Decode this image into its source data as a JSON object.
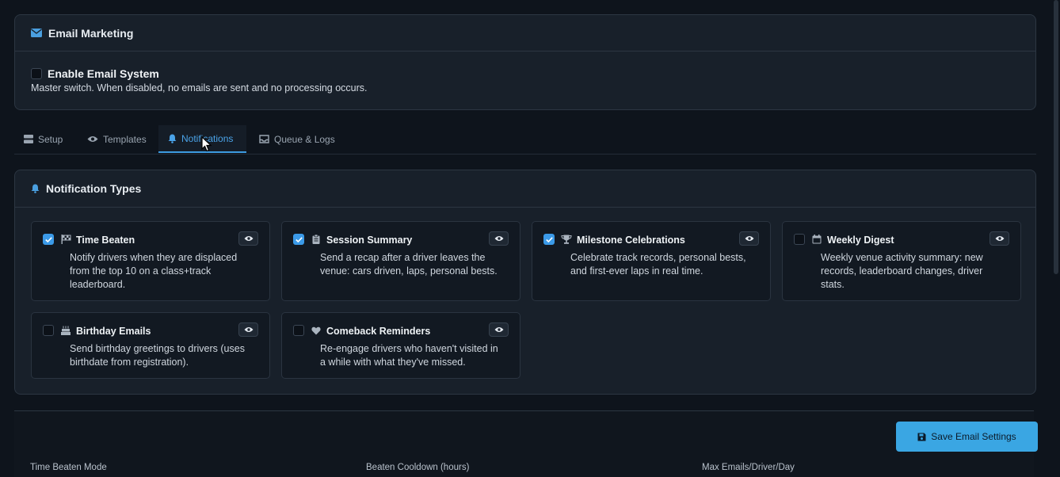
{
  "email_marketing": {
    "title": "Email Marketing",
    "enable_label": "Enable Email System",
    "enable_checked": false,
    "enable_description": "Master switch. When disabled, no emails are sent and no processing occurs."
  },
  "tabs": [
    {
      "label": "Setup",
      "icon": "server-icon",
      "active": false
    },
    {
      "label": "Templates",
      "icon": "eye-icon",
      "active": false
    },
    {
      "label": "Notifications",
      "icon": "bell-icon",
      "active": true
    },
    {
      "label": "Queue & Logs",
      "icon": "inbox-icon",
      "active": false
    }
  ],
  "notification_types": {
    "title": "Notification Types",
    "cards": [
      {
        "title": "Time Beaten",
        "icon": "flag-checkered-icon",
        "checked": true,
        "description": "Notify drivers when they are displaced from the top 10 on a class+track leaderboard."
      },
      {
        "title": "Session Summary",
        "icon": "clipboard-icon",
        "checked": true,
        "description": "Send a recap after a driver leaves the venue: cars driven, laps, personal bests."
      },
      {
        "title": "Milestone Celebrations",
        "icon": "trophy-icon",
        "checked": true,
        "description": "Celebrate track records, personal bests, and first-ever laps in real time."
      },
      {
        "title": "Weekly Digest",
        "icon": "calendar-icon",
        "checked": false,
        "description": "Weekly venue activity summary: new records, leaderboard changes, driver stats."
      },
      {
        "title": "Birthday Emails",
        "icon": "cake-icon",
        "checked": false,
        "description": "Send birthday greetings to drivers (uses birthdate from registration)."
      },
      {
        "title": "Comeback Reminders",
        "icon": "heart-icon",
        "checked": false,
        "description": "Re-engage drivers who haven't visited in a while with what they've missed."
      }
    ]
  },
  "save_button": {
    "label": "Save Email Settings",
    "color": "#3aa6e3"
  },
  "settings_fields": [
    {
      "label": "Time Beaten Mode"
    },
    {
      "label": "Beaten Cooldown (hours)"
    },
    {
      "label": "Max Emails/Driver/Day"
    }
  ],
  "colors": {
    "background": "#0e141c",
    "panel": "#18202a",
    "accent": "#3b9ae8"
  }
}
